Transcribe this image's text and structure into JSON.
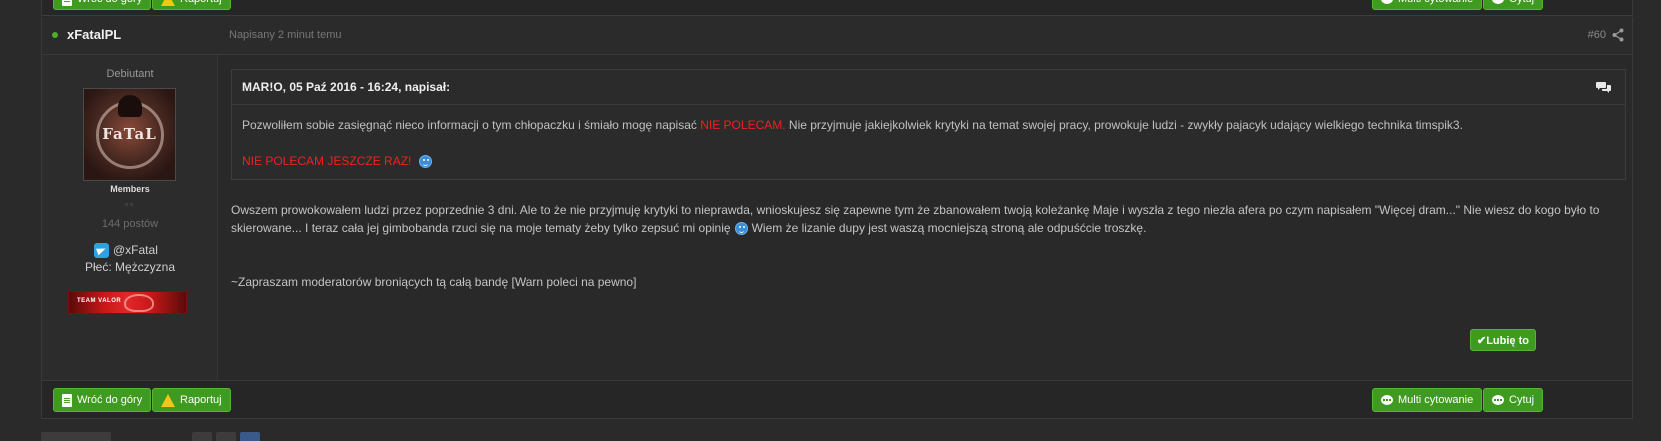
{
  "post": {
    "author": "xFatalPL",
    "date": "Napisany 2 minut temu",
    "number": "#60",
    "line1": "Owszem prowokowałem ludzi przez poprzednie 3 dni. Ale to że nie przyjmuję krytyki to nieprawda, wnioskujesz się zapewne tym że zbanowałem twoją koleżankę Maje i wyszła z tego niezła afera po czym napisałem \"Więcej dram...\" Nie wiesz do kogo było to",
    "line2_a": "skierowane... I teraz cała jej gimbobanda rzuci się na moje tematy żeby tylko zepsuć mi opinię",
    "line2_b": "Wiem że lizanie dupy jest waszą mocniejszą stroną ale odpuśćcie troszkę.",
    "signature": "~Zapraszam moderatorów broniących tą całą bandę [Warn poleci na pewno]"
  },
  "author": {
    "rank": "Debiutant",
    "avatar_text": "FaTaL",
    "group": "Members",
    "pips": "▫▫",
    "post_count": "144 postów",
    "telegram": "@xFatal",
    "gender": "Płeć: Mężczyzna",
    "banner_text": "TEAM VALOR"
  },
  "quote": {
    "citation": "MAR!O, 05 Paź 2016 - 16:24, napisał:",
    "line1_a": "Pozwoliłem sobie zasięgnąć nieco informacji o tym chłopaczku i śmiało mogę napisać ",
    "line1_red": "NIE POLECAM.",
    "line1_b": " Nie przyjmuje jakiejkolwiek krytyki na temat swojej pracy, prowokuje ludzi - zwykły pajacyk udający wielkiego technika timspik3.",
    "line2": "NIE POLECAM JESZCZE RAZ!"
  },
  "buttons": {
    "back_to_top": "Wróć do góry",
    "report": "Raportuj",
    "multi_quote": "Multi cytowanie",
    "quote": "Cytuj",
    "like": "✔Lubię to"
  },
  "colors": {
    "background": "#2a2a2a",
    "button_green": "#3f9a20",
    "quote_highlight_red": "#f02020",
    "online_green": "#4caf2a"
  }
}
